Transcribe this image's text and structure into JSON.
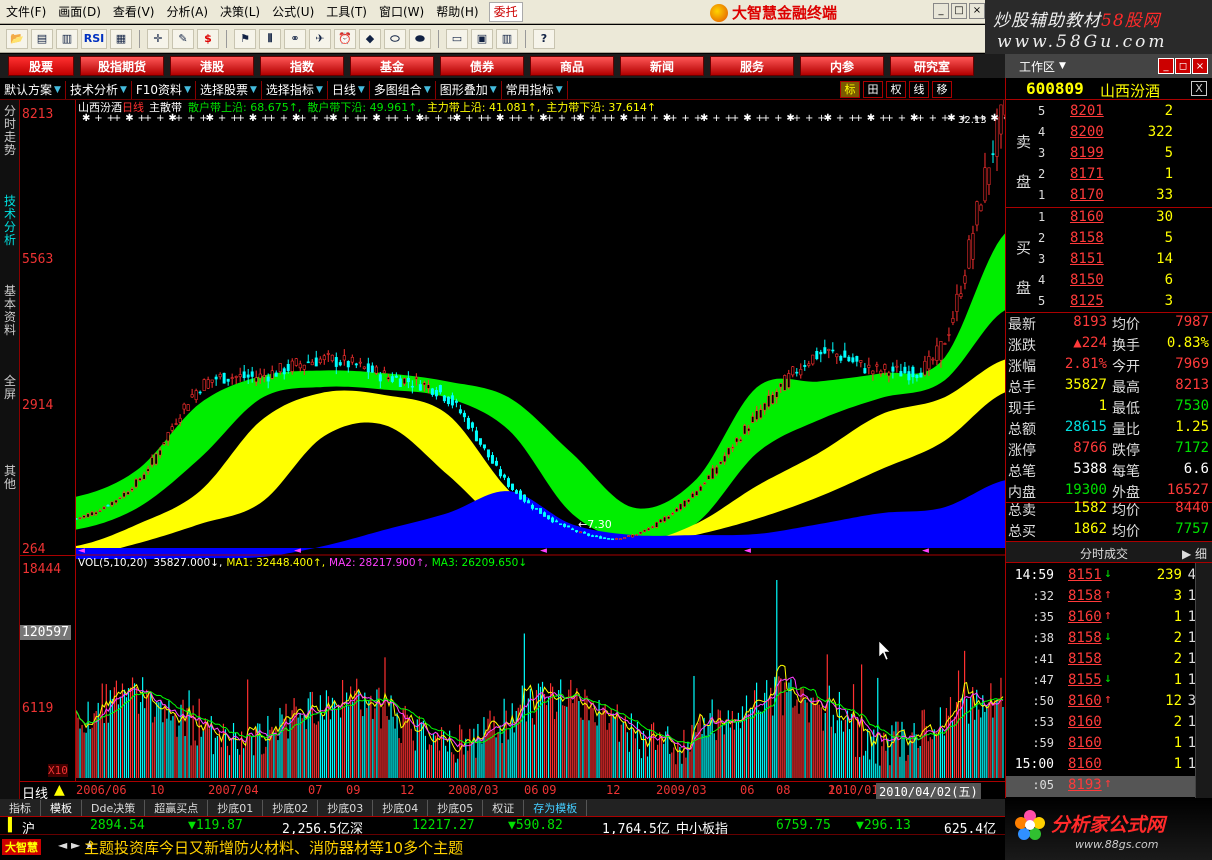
{
  "menubar": {
    "items": [
      "文件(F)",
      "画面(D)",
      "查看(V)",
      "分析(A)",
      "决策(L)",
      "公式(U)",
      "工具(T)",
      "窗口(W)",
      "帮助(H)"
    ],
    "trust": "委托",
    "brand": "大智慧金融终端"
  },
  "watermark_top": {
    "line1_prefix": "炒股辅助教材",
    "line1_accent": "58股网",
    "line2": "www.58Gu.com"
  },
  "toolbar": {
    "icons": [
      "open-icon",
      "chart-icon",
      "bar-icon",
      "rsi-icon",
      "grid-icon",
      "cross-icon",
      "ruler-icon",
      "dollar-icon",
      "flag-icon",
      "bars-icon",
      "binoculars-icon",
      "bird-icon",
      "alarm-icon",
      "diamond-icon",
      "capsule-icon",
      "capsule2-icon",
      "doc-icon",
      "window-icon",
      "books-icon",
      "help-icon"
    ],
    "rsi_label": "RSI",
    "dollar_label": "$"
  },
  "categories": [
    "股票",
    "股指期货",
    "港股",
    "指数",
    "基金",
    "债券",
    "商品",
    "新闻",
    "服务",
    "内参",
    "研究室"
  ],
  "workarea": {
    "label": "工作区"
  },
  "options_bar": {
    "items": [
      "默认方案",
      "技术分析",
      "F10资料",
      "选择股票",
      "选择指标",
      "日线",
      "多图组合",
      "图形叠加",
      "常用指标"
    ],
    "right_buttons": [
      "标",
      "田",
      "权",
      "线",
      "移"
    ]
  },
  "left_tabs": [
    "分时走势",
    "技术分析",
    "基本资料",
    "全屏",
    "其他"
  ],
  "chart": {
    "name": "山西汾酒",
    "period": "日线",
    "indicator": "主散带",
    "legend": [
      {
        "label": "散户带上沿: 68.675↑,",
        "color": "#00e000"
      },
      {
        "label": "散户带下沿: 49.961↑,",
        "color": "#00e000"
      },
      {
        "label": "主力带上沿: 41.081↑,",
        "color": "#ffff00"
      },
      {
        "label": "主力带下沿: 37.614↑",
        "color": "#ffff00"
      }
    ],
    "price_ticks": [
      "8213",
      "5563",
      "2914",
      "264"
    ],
    "low_label": "←7.30",
    "high_label": "32.13",
    "vol_legend": {
      "vol": "VOL(5,10,20)",
      "v": "35827.000↓,",
      "ma1": "MA1: 32448.400↑,",
      "ma2": "MA2: 28217.900↑,",
      "ma3": "MA3: 26209.650↓"
    },
    "vol_ticks": [
      "18444",
      "6119"
    ],
    "vol_highlight": "120597",
    "vol_unit": "X10"
  },
  "chart_data": {
    "type": "area",
    "title": "山西汾酒 日线 主散带",
    "x": [
      "2006/06",
      "2006/10",
      "2007/04",
      "2007/07",
      "2007/09",
      "2007/12",
      "2008/03",
      "2008/06",
      "2008/09",
      "2008/12",
      "2009/03",
      "2009/06",
      "2009/08",
      "2009/10",
      "2010/01",
      "2010/04"
    ],
    "series": [
      {
        "name": "散户带上沿",
        "values": [
          1200,
          1700,
          2900,
          3400,
          3500,
          3450,
          3300,
          3000,
          2000,
          1000,
          1500,
          3200,
          3300,
          3450,
          3700,
          6000
        ]
      },
      {
        "name": "散户带下沿",
        "values": [
          600,
          1000,
          1900,
          3000,
          3200,
          3150,
          3000,
          2400,
          900,
          400,
          700,
          2000,
          2600,
          3000,
          3300,
          4600
        ]
      },
      {
        "name": "主力带上沿",
        "values": [
          300,
          700,
          1300,
          2600,
          3100,
          3050,
          2700,
          1300,
          500,
          350,
          700,
          1400,
          2000,
          2700,
          3000,
          3700
        ]
      },
      {
        "name": "主力带下沿",
        "values": [
          100,
          350,
          700,
          1100,
          2300,
          2500,
          1600,
          600,
          350,
          300,
          500,
          800,
          1200,
          1700,
          2200,
          3100
        ]
      },
      {
        "name": "蓝带",
        "values": [
          50,
          60,
          80,
          100,
          300,
          600,
          900,
          1300,
          700,
          500,
          500,
          520,
          700,
          900,
          1000,
          1500
        ]
      },
      {
        "name": "收盘",
        "values": [
          800,
          1500,
          3200,
          3400,
          3700,
          3400,
          3000,
          1400,
          600,
          500,
          1300,
          2700,
          3800,
          3500,
          4000,
          8193
        ]
      }
    ],
    "ylim": [
      264,
      8213
    ],
    "xlabel": "",
    "ylabel": ""
  },
  "date_axis": [
    "2006/06",
    "10",
    "2007/04",
    "07",
    "09",
    "12",
    "2008/03",
    "06",
    "09",
    "12",
    "2009/03",
    "06",
    "08",
    "10",
    "2010/01"
  ],
  "date_selected": "2010/04/02(五)",
  "date_period": "日线",
  "strategy_tabs": [
    "指标",
    "模板",
    "Dde决策",
    "超赢买点",
    "抄底01",
    "抄底02",
    "抄底03",
    "抄底04",
    "抄底05",
    "权证",
    "存为模板"
  ],
  "ticker": {
    "sh": "沪",
    "sh_index": "2894.54",
    "sh_chg": "▼119.87",
    "sh_amt": "2,256.5亿",
    "sz": "深",
    "sz_index": "12217.27",
    "sz_chg": "▼590.82",
    "sz_amt": "1,764.5亿",
    "sme": "中小板指",
    "sme_index": "6759.75",
    "sme_chg": "▼296.13",
    "sme_amt": "625.4亿"
  },
  "news": {
    "badge": "大智慧",
    "arrows": "◄ ► ★",
    "text": "主题投资库今日又新增防火材料、消防器材等10多个主题"
  },
  "stock": {
    "code": "600809",
    "name": "山西汾酒",
    "close_label": "X"
  },
  "orderbook": {
    "sell_label": "卖盘",
    "buy_label": "买盘",
    "sell": [
      {
        "lv": "5",
        "price": "8201",
        "vol": "2"
      },
      {
        "lv": "4",
        "price": "8200",
        "vol": "322"
      },
      {
        "lv": "3",
        "price": "8199",
        "vol": "5"
      },
      {
        "lv": "2",
        "price": "8171",
        "vol": "1"
      },
      {
        "lv": "1",
        "price": "8170",
        "vol": "33"
      }
    ],
    "buy": [
      {
        "lv": "1",
        "price": "8160",
        "vol": "30"
      },
      {
        "lv": "2",
        "price": "8158",
        "vol": "5"
      },
      {
        "lv": "3",
        "price": "8151",
        "vol": "14"
      },
      {
        "lv": "4",
        "price": "8150",
        "vol": "6"
      },
      {
        "lv": "5",
        "price": "8125",
        "vol": "3"
      }
    ]
  },
  "quote": [
    {
      "k1": "最新",
      "v1": "8193",
      "c1": "red",
      "k2": "均价",
      "v2": "7987",
      "c2": "red"
    },
    {
      "k1": "涨跌",
      "v1": "▲224",
      "c1": "red",
      "k2": "换手",
      "v2": "0.83%",
      "c2": "yellow"
    },
    {
      "k1": "涨幅",
      "v1": "2.81%",
      "c1": "red",
      "k2": "今开",
      "v2": "7969",
      "c2": "red"
    },
    {
      "k1": "总手",
      "v1": "35827",
      "c1": "yellow",
      "k2": "最高",
      "v2": "8213",
      "c2": "red"
    },
    {
      "k1": "现手",
      "v1": "1",
      "c1": "yellow",
      "k2": "最低",
      "v2": "7530",
      "c2": "green"
    },
    {
      "k1": "总额",
      "v1": "28615",
      "c1": "cyan",
      "k2": "量比",
      "v2": "1.25",
      "c2": "yellow"
    },
    {
      "k1": "涨停",
      "v1": "8766",
      "c1": "red",
      "k2": "跌停",
      "v2": "7172",
      "c2": "green"
    },
    {
      "k1": "总笔",
      "v1": "5388",
      "c1": "white",
      "k2": "每笔",
      "v2": "6.6",
      "c2": "white"
    },
    {
      "k1": "内盘",
      "v1": "19300",
      "c1": "green",
      "k2": "外盘",
      "v2": "16527",
      "c2": "red"
    }
  ],
  "totals": [
    {
      "k1": "总卖",
      "v1": "1582",
      "c1": "yellow",
      "k2": "均价",
      "v2": "8440",
      "c2": "red"
    },
    {
      "k1": "总买",
      "v1": "1862",
      "c1": "yellow",
      "k2": "均价",
      "v2": "7757",
      "c2": "green"
    }
  ],
  "ticks_header": {
    "title": "分时成交",
    "detail": "▶ 细"
  },
  "ticks": [
    {
      "t": "14:59",
      "p": "8151",
      "a": "↓",
      "v": "239",
      "c": "4",
      "full": true
    },
    {
      "t": ":32",
      "p": "8158",
      "a": "↑",
      "v": "3",
      "c": "1"
    },
    {
      "t": ":35",
      "p": "8160",
      "a": "↑",
      "v": "1",
      "c": "1"
    },
    {
      "t": ":38",
      "p": "8158",
      "a": "↓",
      "v": "2",
      "c": "1"
    },
    {
      "t": ":41",
      "p": "8158",
      "a": "",
      "v": "2",
      "c": "1"
    },
    {
      "t": ":47",
      "p": "8155",
      "a": "↓",
      "v": "1",
      "c": "1"
    },
    {
      "t": ":50",
      "p": "8160",
      "a": "↑",
      "v": "12",
      "c": "3"
    },
    {
      "t": ":53",
      "p": "8160",
      "a": "",
      "v": "2",
      "c": "1"
    },
    {
      "t": ":59",
      "p": "8160",
      "a": "",
      "v": "1",
      "c": "1"
    },
    {
      "t": "15:00",
      "p": "8160",
      "a": "",
      "v": "1",
      "c": "1",
      "full": true
    },
    {
      "t": ":05",
      "p": "8193",
      "a": "↑",
      "v": "",
      "c": ""
    }
  ],
  "watermark_bot": {
    "title": "分析家公式网",
    "url": "www.88gs.com"
  }
}
